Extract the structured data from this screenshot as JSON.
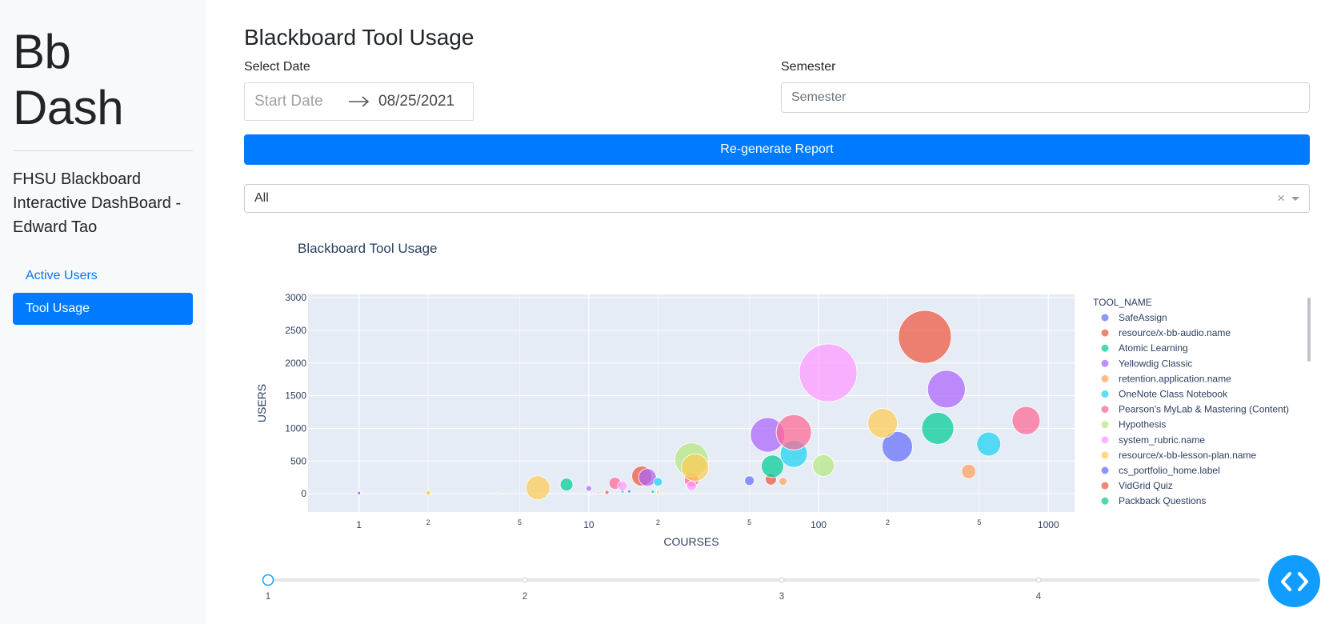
{
  "sidebar": {
    "brand": "Bb Dash",
    "lead": "FHSU Blackboard Interactive DashBoard - Edward Tao",
    "nav": [
      {
        "label": "Active Users",
        "active": false
      },
      {
        "label": "Tool Usage",
        "active": true
      }
    ]
  },
  "main": {
    "title": "Blackboard Tool Usage",
    "date_label": "Select Date",
    "start_placeholder": "Start Date",
    "end_date": "08/25/2021",
    "semester_label": "Semester",
    "semester_placeholder": "Semester",
    "regen_button": "Re-generate Report",
    "dropdown_value": "All",
    "dropdown_clear": "×"
  },
  "icons": {
    "date_arrow": "arrow-right-icon",
    "clear": "close-icon",
    "dropdown": "caret-down-icon",
    "fab": "code-icon"
  },
  "colors": {
    "primary": "#007bff",
    "plot_bg": "#e5ecf6",
    "fab": "#119dff"
  },
  "chart_data": {
    "type": "scatter",
    "title": "Blackboard Tool Usage",
    "xlabel": "COURSES",
    "ylabel": "USERS",
    "x_scale": "log",
    "xlim": [
      0.6,
      1300
    ],
    "ylim": [
      -280,
      3050
    ],
    "y_ticks": [
      0,
      500,
      1000,
      1500,
      2000,
      2500,
      3000
    ],
    "x_ticks_major": [
      {
        "v": 1,
        "label": "1"
      },
      {
        "v": 10,
        "label": "10"
      },
      {
        "v": 100,
        "label": "100"
      },
      {
        "v": 1000,
        "label": "1000"
      }
    ],
    "x_ticks_minor": [
      {
        "v": 2,
        "label": "2"
      },
      {
        "v": 5,
        "label": "5"
      },
      {
        "v": 20,
        "label": "2"
      },
      {
        "v": 50,
        "label": "5"
      },
      {
        "v": 200,
        "label": "2"
      },
      {
        "v": 500,
        "label": "5"
      }
    ],
    "legend_title": "TOOL_NAME",
    "legend_position": "right",
    "series": [
      {
        "name": "SafeAssign",
        "color": "#636efa",
        "points": [
          [
            1,
            15,
            5
          ],
          [
            15,
            35,
            4
          ],
          [
            50,
            200,
            12
          ],
          [
            220,
            720,
            38
          ]
        ]
      },
      {
        "name": "resource/x-bb-audio.name",
        "color": "#ef553b",
        "points": [
          [
            12,
            20,
            5
          ],
          [
            17,
            270,
            25
          ],
          [
            62,
            220,
            14
          ],
          [
            290,
            2400,
            66
          ]
        ]
      },
      {
        "name": "Atomic Learning",
        "color": "#00cc96",
        "points": [
          [
            8,
            140,
            16
          ],
          [
            19,
            30,
            4
          ],
          [
            63,
            420,
            28
          ],
          [
            330,
            1000,
            40
          ]
        ]
      },
      {
        "name": "Yellowdig Classic",
        "color": "#ab63fa",
        "points": [
          [
            1,
            10,
            4
          ],
          [
            10,
            80,
            7
          ],
          [
            18,
            250,
            22
          ],
          [
            60,
            900,
            43
          ],
          [
            360,
            1600,
            47
          ]
        ]
      },
      {
        "name": "retention.application.name",
        "color": "#ffa15a",
        "points": [
          [
            2,
            5,
            4
          ],
          [
            11,
            15,
            3
          ],
          [
            70,
            190,
            10
          ],
          [
            450,
            340,
            18
          ]
        ]
      },
      {
        "name": "OneNote Class Notebook",
        "color": "#19d3f3",
        "points": [
          [
            14,
            40,
            5
          ],
          [
            20,
            180,
            11
          ],
          [
            78,
            610,
            34
          ],
          [
            550,
            760,
            30
          ]
        ]
      },
      {
        "name": "Pearson's MyLab & Mastering (Content)",
        "color": "#ff6692",
        "points": [
          [
            13,
            160,
            15
          ],
          [
            28,
            210,
            18
          ],
          [
            78,
            940,
            44
          ],
          [
            800,
            1120,
            35
          ]
        ]
      },
      {
        "name": "Hypothesis",
        "color": "#b6e880",
        "points": [
          [
            4,
            5,
            3
          ],
          [
            28,
            520,
            42
          ],
          [
            105,
            430,
            27
          ]
        ]
      },
      {
        "name": "system_rubric.name",
        "color": "#ff97ff",
        "points": [
          [
            14,
            120,
            12
          ],
          [
            28,
            120,
            12
          ],
          [
            110,
            1850,
            72
          ]
        ]
      },
      {
        "name": "resource/x-bb-lesson-plan.name",
        "color": "#fecb52",
        "points": [
          [
            2,
            15,
            6
          ],
          [
            6,
            90,
            30
          ],
          [
            20,
            25,
            4
          ],
          [
            29,
            400,
            34
          ],
          [
            190,
            1080,
            37
          ]
        ]
      },
      {
        "name": "cs_portfolio_home.label",
        "color": "#636efa",
        "points": []
      },
      {
        "name": "VidGrid Quiz",
        "color": "#ef553b",
        "points": []
      },
      {
        "name": "Packback Questions",
        "color": "#00cc96",
        "points": []
      }
    ],
    "slider": {
      "ticks": [
        "1",
        "2",
        "3",
        "4"
      ],
      "value": 1
    }
  }
}
